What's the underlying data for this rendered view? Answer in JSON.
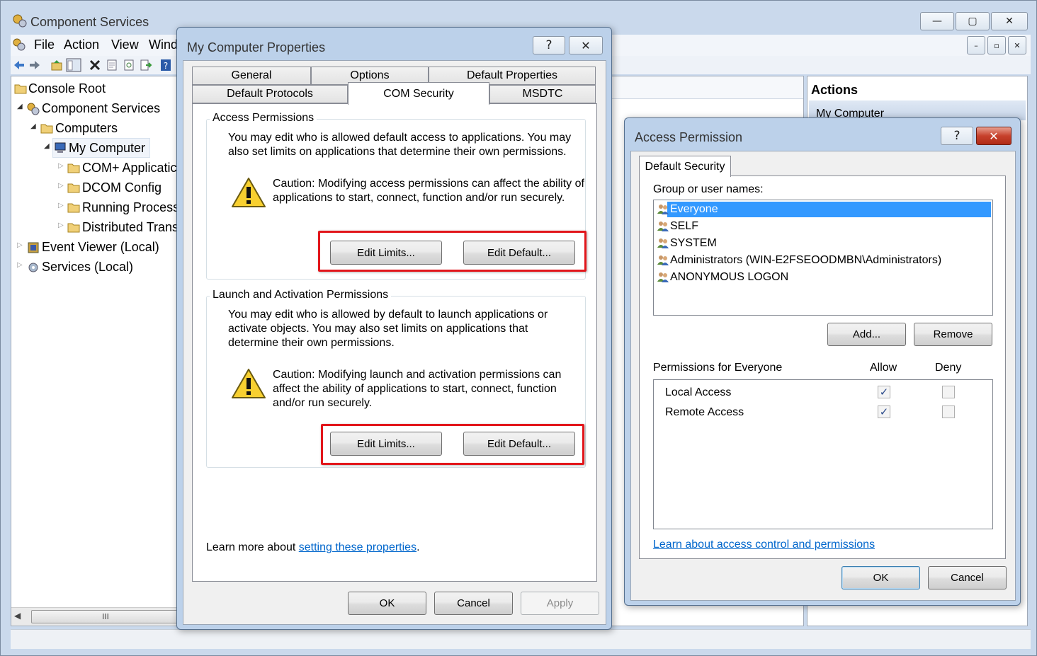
{
  "main_window": {
    "title": "Component Services",
    "menu": [
      "File",
      "Action",
      "View",
      "Wind"
    ],
    "tree": {
      "console_root": "Console Root",
      "component_services": "Component Services",
      "computers": "Computers",
      "my_computer": "My Computer",
      "com_plus": "COM+ Applicatic",
      "dcom_config": "DCOM Config",
      "running_processes": "Running Processe",
      "distributed_trans": "Distributed Trans",
      "event_viewer": "Event Viewer (Local)",
      "services": "Services (Local)"
    },
    "actions_header": "Actions",
    "actions_item": "My Computer",
    "scroll_grip": "III"
  },
  "props_dialog": {
    "title": "My Computer Properties",
    "help_glyph": "?",
    "close_glyph": "✕",
    "tabs_row1": [
      "General",
      "Options",
      "Default Properties"
    ],
    "tabs_row2": [
      "Default Protocols",
      "COM Security",
      "MSDTC"
    ],
    "access_group": {
      "legend": "Access Permissions",
      "description": "You may edit who is allowed default access to applications. You may also set limits on applications that determine their own permissions.",
      "caution": "Caution: Modifying access permissions can affect the ability of applications to start, connect, function and/or run securely.",
      "edit_limits": "Edit Limits...",
      "edit_default": "Edit Default..."
    },
    "launch_group": {
      "legend": "Launch and Activation Permissions",
      "description": "You may edit who is allowed by default to launch applications or activate objects. You may also set limits on applications that determine their own permissions.",
      "caution": "Caution: Modifying launch and activation permissions can affect the ability of applications to start, connect, function and/or run securely.",
      "edit_limits": "Edit Limits...",
      "edit_default": "Edit Default..."
    },
    "learn_prefix": "Learn more about ",
    "learn_link": "setting these properties",
    "learn_suffix": ".",
    "ok": "OK",
    "cancel": "Cancel",
    "apply": "Apply"
  },
  "access_dialog": {
    "title": "Access Permission",
    "help_glyph": "?",
    "close_glyph": "✕",
    "tab": "Default Security",
    "group_label": "Group or user names:",
    "users": [
      "Everyone",
      "SELF",
      "SYSTEM",
      "Administrators (WIN-E2FSEOODMBN\\Administrators)",
      "ANONYMOUS LOGON"
    ],
    "add": "Add...",
    "remove": "Remove",
    "perm_label": "Permissions for Everyone",
    "allow_col": "Allow",
    "deny_col": "Deny",
    "permissions": [
      {
        "name": "Local Access",
        "allow": true,
        "deny": false
      },
      {
        "name": "Remote Access",
        "allow": true,
        "deny": false
      }
    ],
    "check_glyph": "✓",
    "learn_link": "Learn about access control and permissions",
    "ok": "OK",
    "cancel": "Cancel"
  },
  "colors": {
    "selection": "#3399ff",
    "highlight_box": "#e2161b",
    "link": "#0066cc"
  }
}
